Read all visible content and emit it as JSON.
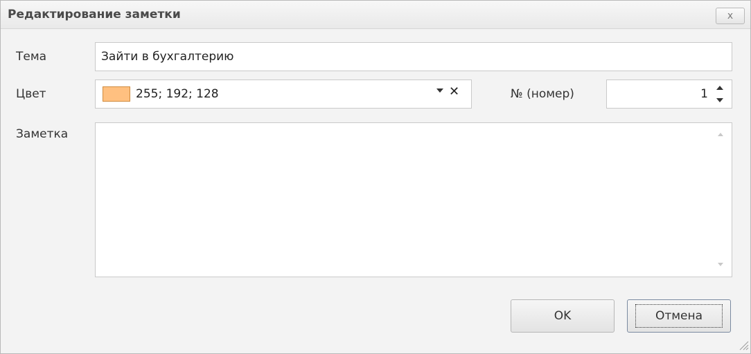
{
  "dialog": {
    "title": "Редактирование заметки",
    "close_glyph": "x"
  },
  "form": {
    "subject": {
      "label": "Тема",
      "value": "Зайти в бухгалтерию"
    },
    "color": {
      "label": "Цвет",
      "value": "255; 192; 128",
      "swatch": "#ffc080"
    },
    "number": {
      "label": "№ (номер)",
      "value": "1"
    },
    "note": {
      "label": "Заметка",
      "value": ""
    }
  },
  "buttons": {
    "ok": "OK",
    "cancel": "Отмена"
  },
  "icons": {
    "close": "close-icon",
    "dropdown": "chevron-down-icon",
    "clear": "clear-icon",
    "spin_up": "spin-up-icon",
    "spin_down": "spin-down-icon",
    "resize": "resize-grip-icon"
  }
}
